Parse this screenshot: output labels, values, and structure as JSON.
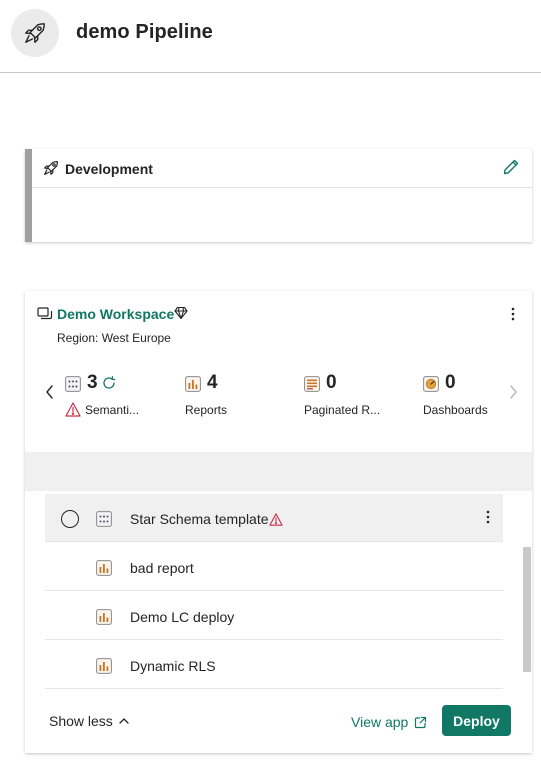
{
  "header": {
    "title": "demo Pipeline",
    "icon": "rocket-icon"
  },
  "stage": {
    "name": "Development",
    "icon": "rocket-icon",
    "edit_icon": "pencil-icon"
  },
  "workspace": {
    "name": "Demo Workspace",
    "premium_icon": "diamond-icon",
    "region": "Region: West Europe",
    "tiles": [
      {
        "count": "3",
        "label": "Semanti...",
        "icon": "semantic-model-icon",
        "has_refresh": true,
        "has_warning": true
      },
      {
        "count": "4",
        "label": "Reports",
        "icon": "report-icon"
      },
      {
        "count": "0",
        "label": "Paginated R...",
        "icon": "paginated-report-icon"
      },
      {
        "count": "0",
        "label": "Dashboards",
        "icon": "dashboard-icon"
      }
    ],
    "items": [
      {
        "name": "Star Schema template",
        "icon": "semantic-model-icon",
        "selected": true,
        "warning": true
      },
      {
        "name": "bad report",
        "icon": "report-icon"
      },
      {
        "name": "Demo LC deploy",
        "icon": "report-icon"
      },
      {
        "name": "Dynamic RLS",
        "icon": "report-icon"
      }
    ],
    "show_less_label": "Show less",
    "view_app_label": "View app",
    "deploy_label": "Deploy"
  },
  "colors": {
    "accent": "#117865",
    "warning": "#c4314b",
    "stage_bar": "#a19f9d",
    "report_orange": "#c8742a"
  }
}
